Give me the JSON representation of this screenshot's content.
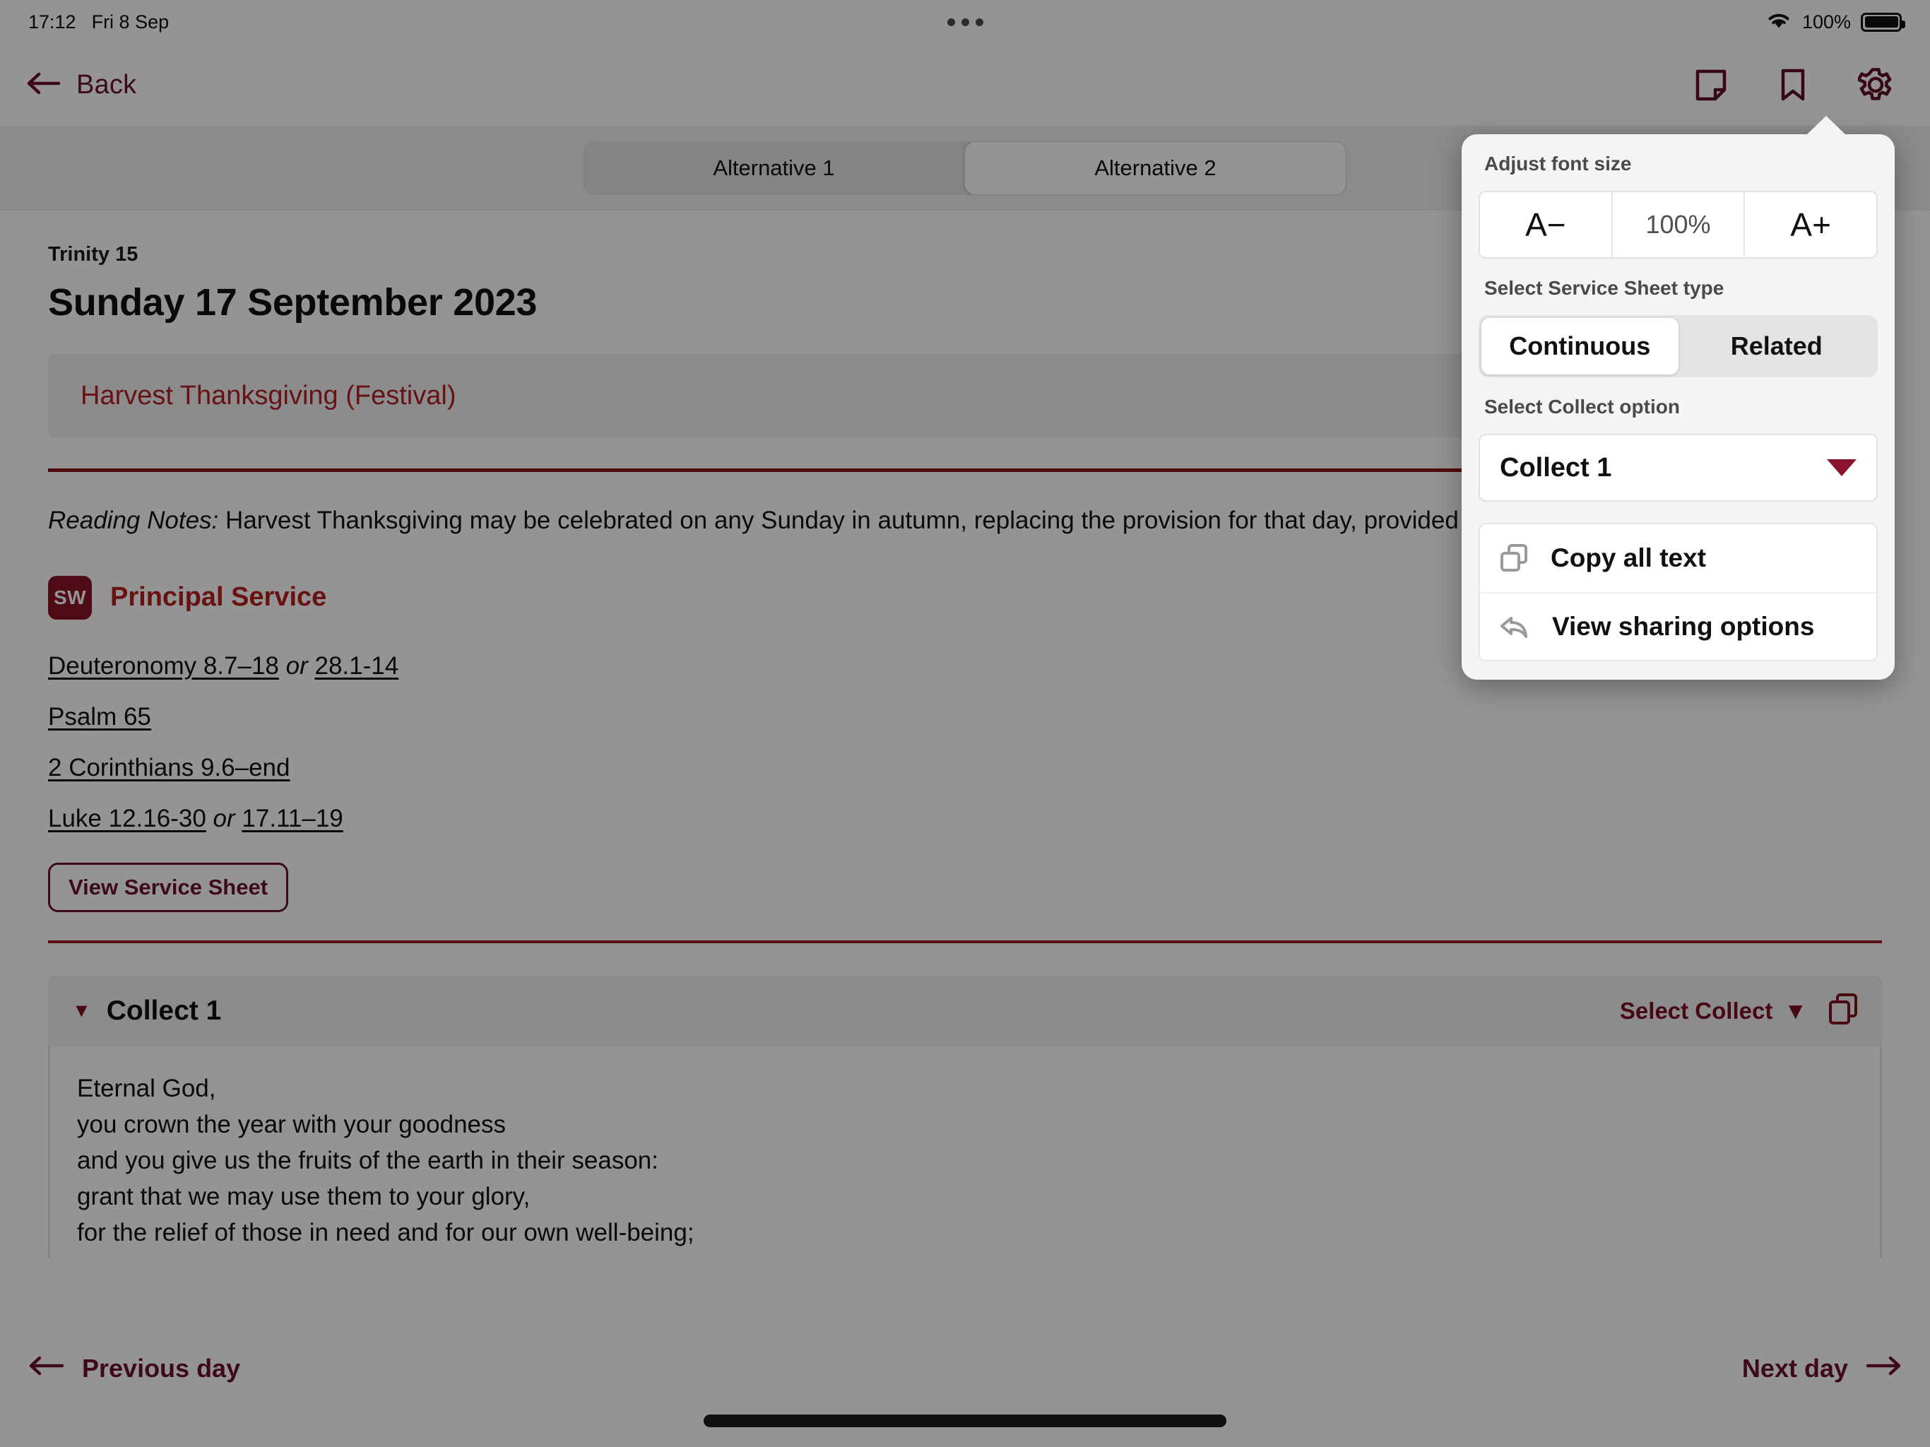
{
  "statusbar": {
    "time": "17:12",
    "date": "Fri 8 Sep",
    "battery_percent": "100%",
    "wifi_icon": "wifi-icon",
    "battery_icon": "battery-full-icon"
  },
  "header": {
    "back_label": "Back",
    "back_icon": "arrow-left-icon",
    "icons": [
      {
        "name": "note-icon"
      },
      {
        "name": "bookmark-icon"
      },
      {
        "name": "gear-icon"
      }
    ]
  },
  "tabs": [
    {
      "label": "Alternative 1",
      "selected": false
    },
    {
      "label": "Alternative 2",
      "selected": true
    }
  ],
  "main": {
    "eyebrow": "Trinity 15",
    "day_title": "Sunday 17 September 2023",
    "festival": "Harvest Thanksgiving (Festival)",
    "reading_notes_label": "Reading Notes:",
    "reading_notes_text": "Harvest Thanksgiving may be celebrated on any Sunday in autumn, replacing the provision for that day, provided it is not a Principal Feast or Festival.",
    "service_badge": "SW",
    "service_name": "Principal Service",
    "readings": [
      {
        "primary": "Deuteronomy 8.7–18",
        "conjunction": "or",
        "alternate": "28.1-14"
      },
      {
        "primary": "Psalm 65",
        "conjunction": "",
        "alternate": ""
      },
      {
        "primary": "2 Corinthians 9.6–end",
        "conjunction": "",
        "alternate": ""
      },
      {
        "primary": "Luke 12.16-30",
        "conjunction": "or",
        "alternate": "17.11–19"
      }
    ],
    "view_sheet_label": "View Service Sheet",
    "collect": {
      "title": "Collect 1",
      "collapse_icon": "triangle-down-icon",
      "select_label": "Select Collect",
      "select_caret": "triangle-down-icon",
      "copy_icon": "copy-icon",
      "lines": [
        "Eternal God,",
        "you crown the year with your goodness",
        "and you give us the fruits of the earth in their season:",
        "grant that we may use them to your glory,",
        "for the relief of those in need and for our own well-being;"
      ]
    }
  },
  "bottomnav": {
    "previous_label": "Previous day",
    "previous_icon": "arrow-left-icon",
    "next_label": "Next day",
    "next_icon": "arrow-right-icon"
  },
  "popover": {
    "font_size_label": "Adjust font size",
    "font_decrease": "A−",
    "font_percent": "100%",
    "font_increase": "A+",
    "sheet_type_label": "Select Service Sheet type",
    "sheet_types": [
      {
        "label": "Continuous",
        "selected": true
      },
      {
        "label": "Related",
        "selected": false
      }
    ],
    "collect_option_label": "Select Collect option",
    "collect_option_value": "Collect 1",
    "menu": [
      {
        "label": "Copy all text",
        "icon": "copy-icon"
      },
      {
        "label": "View sharing options",
        "icon": "reply-arrow-icon"
      }
    ]
  },
  "colors": {
    "brand_dark_red": "#6b122b",
    "brand_red": "#b3201f",
    "rule_red": "#8f1216",
    "badge_red": "#8a1626"
  }
}
